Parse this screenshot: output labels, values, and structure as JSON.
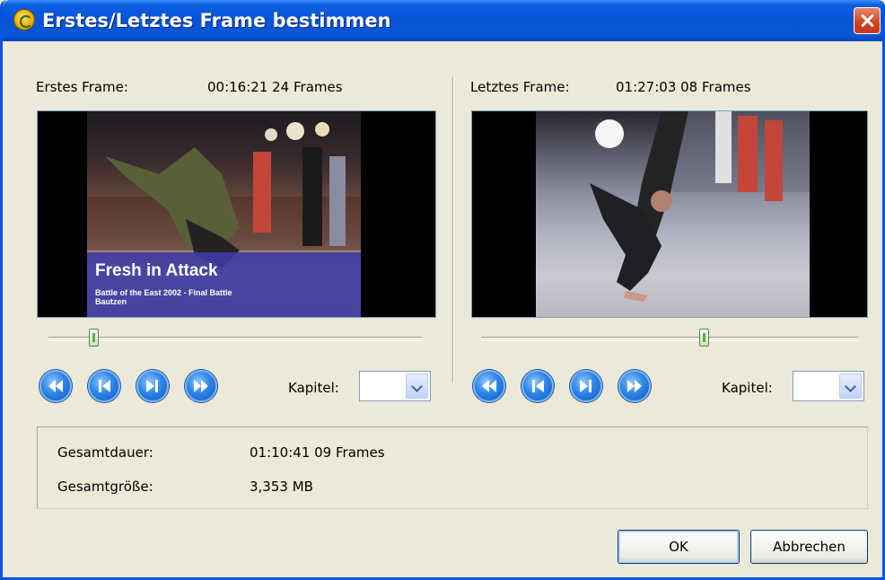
{
  "window": {
    "title": "Erstes/Letztes Frame bestimmen"
  },
  "first": {
    "label": "Erstes Frame:",
    "time": "00:16:21 24 Frames",
    "overlay_title": "Fresh in Attack",
    "overlay_subtitle_line1": "Battle of the East 2002 - Final Battle",
    "overlay_subtitle_line2": "Bautzen",
    "slider_fraction": 0.12,
    "chapter_label": "Kapitel:",
    "chapter_value": ""
  },
  "last": {
    "label": "Letztes Frame:",
    "time": "01:27:03 08 Frames",
    "slider_fraction": 0.59,
    "chapter_label": "Kapitel:",
    "chapter_value": ""
  },
  "summary": {
    "duration_label": "Gesamtdauer:",
    "duration_value": "01:10:41 09 Frames",
    "size_label": "Gesamtgröße:",
    "size_value": "3,353 MB"
  },
  "buttons": {
    "ok": "OK",
    "cancel": "Abbrechen"
  },
  "icons": {
    "nav": [
      "skip-back-icon",
      "step-back-icon",
      "step-forward-icon",
      "skip-forward-icon"
    ]
  },
  "colors": {
    "titlebar": "#0A5FE0",
    "overlay_band": "#3E3CA0",
    "close": "#D2401E"
  }
}
